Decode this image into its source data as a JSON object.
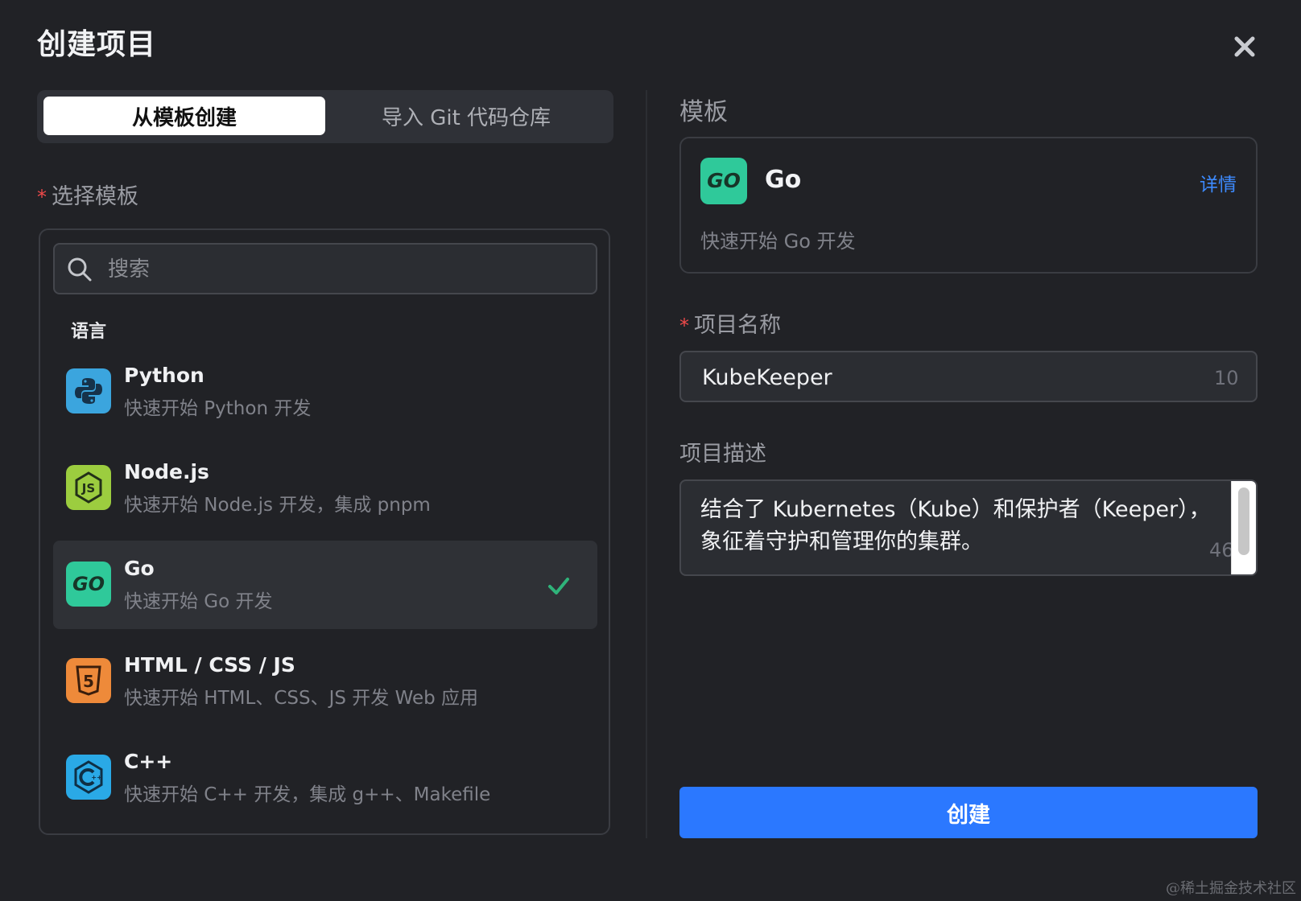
{
  "dialog": {
    "title": "创建项目"
  },
  "tabs": [
    {
      "label": "从模板创建",
      "active": true
    },
    {
      "label": "导入 Git 代码仓库",
      "active": false
    }
  ],
  "left": {
    "select_label": "选择模板",
    "search_placeholder": "搜索",
    "group_label": "语言",
    "items": [
      {
        "name": "Python",
        "desc": "快速开始 Python 开发",
        "icon": "python-icon",
        "selected": false
      },
      {
        "name": "Node.js",
        "desc": "快速开始 Node.js 开发，集成 pnpm",
        "icon": "nodejs-icon",
        "selected": false
      },
      {
        "name": "Go",
        "desc": "快速开始 Go 开发",
        "icon": "go-icon",
        "selected": true
      },
      {
        "name": "HTML / CSS / JS",
        "desc": "快速开始 HTML、CSS、JS 开发 Web 应用",
        "icon": "html5-icon",
        "selected": false
      },
      {
        "name": "C++",
        "desc": "快速开始 C++ 开发，集成 g++、Makefile",
        "icon": "cpp-icon",
        "selected": false
      }
    ]
  },
  "right": {
    "template_label": "模板",
    "template": {
      "name": "Go",
      "detail_link": "详情",
      "desc": "快速开始 Go 开发",
      "icon": "go-icon"
    },
    "name_label": "项目名称",
    "name_value": "KubeKeeper",
    "name_count": "10",
    "desc_label": "项目描述",
    "desc_value": "结合了 Kubernetes（Kube）和保护者（Keeper），象征着守护和管理你的集群。",
    "desc_count": "46",
    "create_button": "创建"
  },
  "watermark": "@稀土掘金技术社区",
  "colors": {
    "background": "#212226",
    "accent": "#2b78ff",
    "link": "#3d8bff",
    "required": "#ef4a4a",
    "check": "#2fb37a"
  }
}
